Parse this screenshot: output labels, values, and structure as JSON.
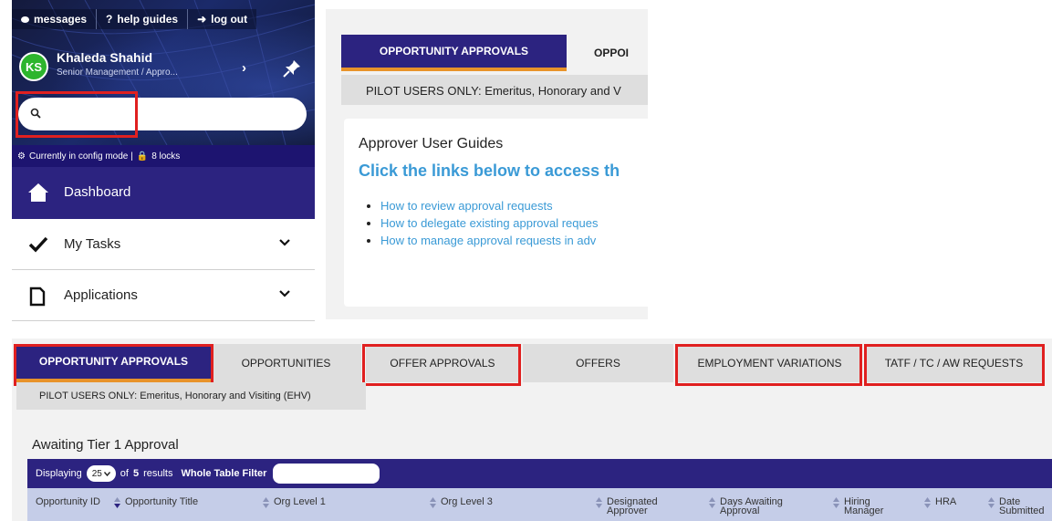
{
  "sidebar": {
    "topbar": {
      "messages": "messages",
      "help": "help guides",
      "logout": "log out"
    },
    "user": {
      "initials": "KS",
      "name": "Khaleda Shahid",
      "role": "Senior Management / Appro..."
    },
    "search": {
      "placeholder": ""
    },
    "config_status": "Currently in config mode |",
    "locks": "8 locks",
    "nav": {
      "dashboard": "Dashboard",
      "my_tasks": "My Tasks",
      "applications": "Applications"
    }
  },
  "top_panel": {
    "tab_active": "OPPORTUNITY APPROVALS",
    "tab_next": "OPPOI",
    "pilot": "PILOT USERS ONLY: Emeritus, Honorary and V",
    "guides": {
      "title": "Approver User Guides",
      "link_heading": "Click the links below to access th",
      "links": [
        "How to review approval requests",
        "How to delegate existing approval reques",
        "How to manage approval requests in adv"
      ]
    }
  },
  "bottom_panel": {
    "tabs": [
      "OPPORTUNITY APPROVALS",
      "OPPORTUNITIES",
      "OFFER APPROVALS",
      "OFFERS",
      "EMPLOYMENT VARIATIONS",
      "TATF / TC / AW REQUESTS"
    ],
    "pilot": "PILOT USERS ONLY: Emeritus, Honorary and Visiting (EHV)",
    "section_title": "Awaiting Tier 1 Approval",
    "table_bar": {
      "displaying": "Displaying",
      "page_size": "25",
      "of_prefix": "of",
      "results_count": "5",
      "results_suffix": "results",
      "filter_label": "Whole Table Filter"
    },
    "columns": [
      "Opportunity ID",
      "Opportunity Title",
      "Org Level 1",
      "Org Level 3",
      "Designated Approver",
      "Days Awaiting Approval",
      "Hiring Manager",
      "HRA",
      "Date Submitted"
    ]
  },
  "colors": {
    "primary": "#2c2380",
    "accent": "#e8932a",
    "highlight": "#e02020",
    "link": "#3a9ad6",
    "avatar": "#2db52d"
  }
}
